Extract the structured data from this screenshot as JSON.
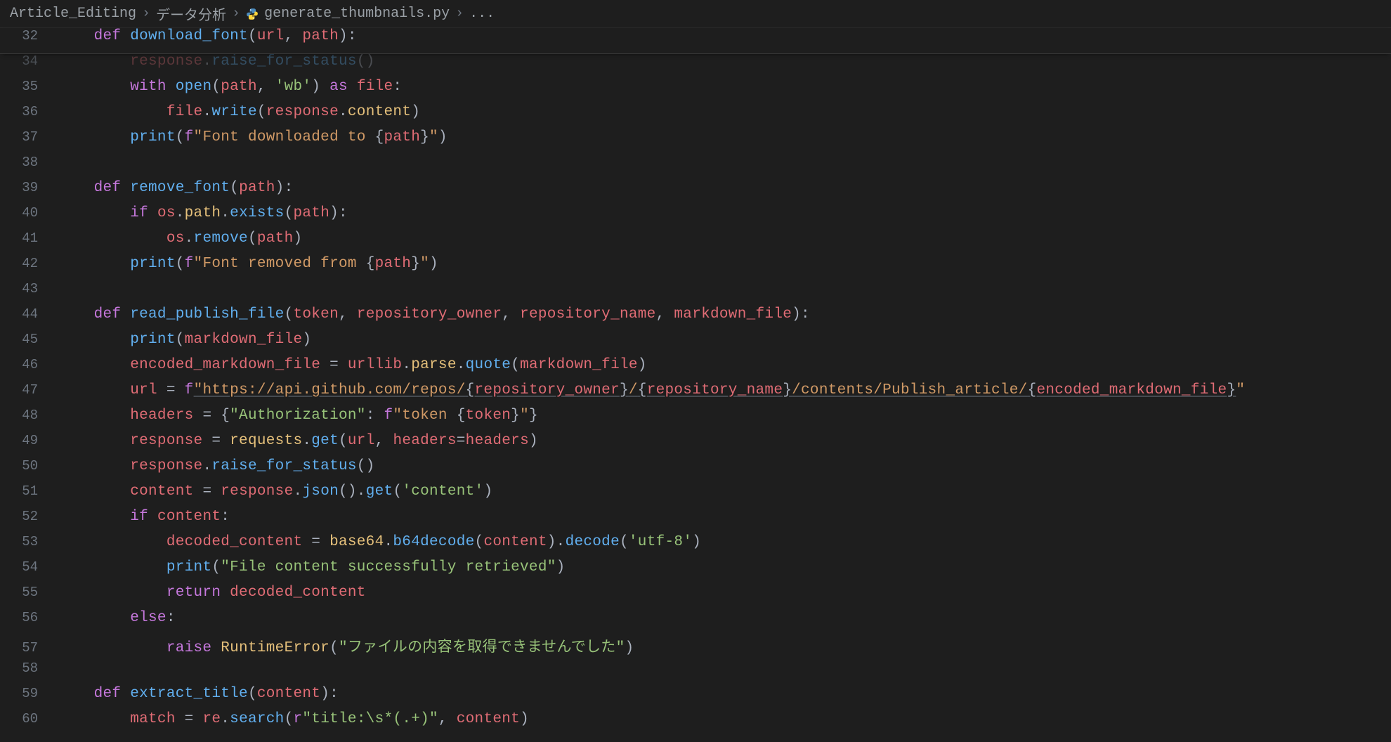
{
  "breadcrumb": {
    "parts": [
      "Article_Editing",
      "データ分析",
      "generate_thumbnails.py",
      "..."
    ],
    "file_icon": "python"
  },
  "sticky": {
    "num": "32",
    "tokens": [
      {
        "c": "kw",
        "t": "def "
      },
      {
        "c": "fn",
        "t": "download_font"
      },
      {
        "c": "op",
        "t": "("
      },
      {
        "c": "id",
        "t": "url"
      },
      {
        "c": "op",
        "t": ", "
      },
      {
        "c": "id",
        "t": "path"
      },
      {
        "c": "op",
        "t": "):"
      }
    ]
  },
  "lines": [
    {
      "num": "34",
      "faded": true,
      "indent": 2,
      "tokens": [
        {
          "c": "id",
          "t": "response"
        },
        {
          "c": "op",
          "t": "."
        },
        {
          "c": "call",
          "t": "raise_for_status"
        },
        {
          "c": "op",
          "t": "()"
        }
      ]
    },
    {
      "num": "35",
      "indent": 2,
      "tokens": [
        {
          "c": "kw",
          "t": "with"
        },
        {
          "c": "op",
          "t": " "
        },
        {
          "c": "call",
          "t": "open"
        },
        {
          "c": "op",
          "t": "("
        },
        {
          "c": "id",
          "t": "path"
        },
        {
          "c": "op",
          "t": ", "
        },
        {
          "c": "str",
          "t": "'wb'"
        },
        {
          "c": "op",
          "t": ") "
        },
        {
          "c": "kw",
          "t": "as"
        },
        {
          "c": "op",
          "t": " "
        },
        {
          "c": "id",
          "t": "file"
        },
        {
          "c": "op",
          "t": ":"
        }
      ]
    },
    {
      "num": "36",
      "indent": 3,
      "tokens": [
        {
          "c": "id",
          "t": "file"
        },
        {
          "c": "op",
          "t": "."
        },
        {
          "c": "call",
          "t": "write"
        },
        {
          "c": "op",
          "t": "("
        },
        {
          "c": "id",
          "t": "response"
        },
        {
          "c": "op",
          "t": "."
        },
        {
          "c": "attr",
          "t": "content"
        },
        {
          "c": "op",
          "t": ")"
        }
      ]
    },
    {
      "num": "37",
      "indent": 2,
      "tokens": [
        {
          "c": "call",
          "t": "print"
        },
        {
          "c": "op",
          "t": "("
        },
        {
          "c": "kw",
          "t": "f"
        },
        {
          "c": "fstr",
          "t": "\"Font downloaded to "
        },
        {
          "c": "op",
          "t": "{"
        },
        {
          "c": "interp",
          "t": "path"
        },
        {
          "c": "op",
          "t": "}"
        },
        {
          "c": "fstr",
          "t": "\""
        },
        {
          "c": "op",
          "t": ")"
        }
      ]
    },
    {
      "num": "38",
      "indent": 0,
      "tokens": []
    },
    {
      "num": "39",
      "indent": 1,
      "tokens": [
        {
          "c": "kw",
          "t": "def "
        },
        {
          "c": "fn",
          "t": "remove_font"
        },
        {
          "c": "op",
          "t": "("
        },
        {
          "c": "id",
          "t": "path"
        },
        {
          "c": "op",
          "t": "):"
        }
      ]
    },
    {
      "num": "40",
      "indent": 2,
      "tokens": [
        {
          "c": "kw",
          "t": "if"
        },
        {
          "c": "op",
          "t": " "
        },
        {
          "c": "id",
          "t": "os"
        },
        {
          "c": "op",
          "t": "."
        },
        {
          "c": "attr",
          "t": "path"
        },
        {
          "c": "op",
          "t": "."
        },
        {
          "c": "call",
          "t": "exists"
        },
        {
          "c": "op",
          "t": "("
        },
        {
          "c": "id",
          "t": "path"
        },
        {
          "c": "op",
          "t": "):"
        }
      ]
    },
    {
      "num": "41",
      "indent": 3,
      "tokens": [
        {
          "c": "id",
          "t": "os"
        },
        {
          "c": "op",
          "t": "."
        },
        {
          "c": "call",
          "t": "remove"
        },
        {
          "c": "op",
          "t": "("
        },
        {
          "c": "id",
          "t": "path"
        },
        {
          "c": "op",
          "t": ")"
        }
      ]
    },
    {
      "num": "42",
      "indent": 2,
      "tokens": [
        {
          "c": "call",
          "t": "print"
        },
        {
          "c": "op",
          "t": "("
        },
        {
          "c": "kw",
          "t": "f"
        },
        {
          "c": "fstr",
          "t": "\"Font removed from "
        },
        {
          "c": "op",
          "t": "{"
        },
        {
          "c": "interp",
          "t": "path"
        },
        {
          "c": "op",
          "t": "}"
        },
        {
          "c": "fstr",
          "t": "\""
        },
        {
          "c": "op",
          "t": ")"
        }
      ]
    },
    {
      "num": "43",
      "indent": 0,
      "tokens": []
    },
    {
      "num": "44",
      "indent": 1,
      "tokens": [
        {
          "c": "kw",
          "t": "def "
        },
        {
          "c": "fn",
          "t": "read_publish_file"
        },
        {
          "c": "op",
          "t": "("
        },
        {
          "c": "id",
          "t": "token"
        },
        {
          "c": "op",
          "t": ", "
        },
        {
          "c": "id",
          "t": "repository_owner"
        },
        {
          "c": "op",
          "t": ", "
        },
        {
          "c": "id",
          "t": "repository_name"
        },
        {
          "c": "op",
          "t": ", "
        },
        {
          "c": "id",
          "t": "markdown_file"
        },
        {
          "c": "op",
          "t": "):"
        }
      ]
    },
    {
      "num": "45",
      "indent": 2,
      "tokens": [
        {
          "c": "call",
          "t": "print"
        },
        {
          "c": "op",
          "t": "("
        },
        {
          "c": "id",
          "t": "markdown_file"
        },
        {
          "c": "op",
          "t": ")"
        }
      ]
    },
    {
      "num": "46",
      "indent": 2,
      "tokens": [
        {
          "c": "id",
          "t": "encoded_markdown_file"
        },
        {
          "c": "op",
          "t": " = "
        },
        {
          "c": "id",
          "t": "urllib"
        },
        {
          "c": "op",
          "t": "."
        },
        {
          "c": "attr",
          "t": "parse"
        },
        {
          "c": "op",
          "t": "."
        },
        {
          "c": "call",
          "t": "quote"
        },
        {
          "c": "op",
          "t": "("
        },
        {
          "c": "id",
          "t": "markdown_file"
        },
        {
          "c": "op",
          "t": ")"
        }
      ]
    },
    {
      "num": "47",
      "indent": 2,
      "tokens": [
        {
          "c": "id",
          "t": "url"
        },
        {
          "c": "op",
          "t": " = "
        },
        {
          "c": "kw",
          "t": "f"
        },
        {
          "c": "fstr url",
          "t": "\"https://api.github.com/repos/"
        },
        {
          "c": "op url",
          "t": "{"
        },
        {
          "c": "interp url",
          "t": "repository_owner"
        },
        {
          "c": "op url",
          "t": "}"
        },
        {
          "c": "fstr url",
          "t": "/"
        },
        {
          "c": "op url",
          "t": "{"
        },
        {
          "c": "interp url",
          "t": "repository_name"
        },
        {
          "c": "op url",
          "t": "}"
        },
        {
          "c": "fstr url",
          "t": "/contents/Publish_article/"
        },
        {
          "c": "op url",
          "t": "{"
        },
        {
          "c": "interp url",
          "t": "encoded_markdown_file"
        },
        {
          "c": "op url",
          "t": "}"
        },
        {
          "c": "fstr",
          "t": "\""
        }
      ]
    },
    {
      "num": "48",
      "indent": 2,
      "tokens": [
        {
          "c": "id",
          "t": "headers"
        },
        {
          "c": "op",
          "t": " = {"
        },
        {
          "c": "str",
          "t": "\"Authorization\""
        },
        {
          "c": "op",
          "t": ": "
        },
        {
          "c": "kw",
          "t": "f"
        },
        {
          "c": "fstr",
          "t": "\"token "
        },
        {
          "c": "op",
          "t": "{"
        },
        {
          "c": "interp",
          "t": "token"
        },
        {
          "c": "op",
          "t": "}"
        },
        {
          "c": "fstr",
          "t": "\""
        },
        {
          "c": "op",
          "t": "}"
        }
      ]
    },
    {
      "num": "49",
      "indent": 2,
      "tokens": [
        {
          "c": "id",
          "t": "response"
        },
        {
          "c": "op",
          "t": " = "
        },
        {
          "c": "attr",
          "t": "requests"
        },
        {
          "c": "op",
          "t": "."
        },
        {
          "c": "call",
          "t": "get"
        },
        {
          "c": "op",
          "t": "("
        },
        {
          "c": "id",
          "t": "url"
        },
        {
          "c": "op",
          "t": ", "
        },
        {
          "c": "id",
          "t": "headers"
        },
        {
          "c": "op",
          "t": "="
        },
        {
          "c": "id",
          "t": "headers"
        },
        {
          "c": "op",
          "t": ")"
        }
      ]
    },
    {
      "num": "50",
      "indent": 2,
      "tokens": [
        {
          "c": "id",
          "t": "response"
        },
        {
          "c": "op",
          "t": "."
        },
        {
          "c": "call",
          "t": "raise_for_status"
        },
        {
          "c": "op",
          "t": "()"
        }
      ]
    },
    {
      "num": "51",
      "indent": 2,
      "tokens": [
        {
          "c": "id",
          "t": "content"
        },
        {
          "c": "op",
          "t": " = "
        },
        {
          "c": "id",
          "t": "response"
        },
        {
          "c": "op",
          "t": "."
        },
        {
          "c": "call",
          "t": "json"
        },
        {
          "c": "op",
          "t": "()."
        },
        {
          "c": "call",
          "t": "get"
        },
        {
          "c": "op",
          "t": "("
        },
        {
          "c": "str",
          "t": "'content'"
        },
        {
          "c": "op",
          "t": ")"
        }
      ]
    },
    {
      "num": "52",
      "indent": 2,
      "tokens": [
        {
          "c": "kw",
          "t": "if"
        },
        {
          "c": "op",
          "t": " "
        },
        {
          "c": "id",
          "t": "content"
        },
        {
          "c": "op",
          "t": ":"
        }
      ]
    },
    {
      "num": "53",
      "indent": 3,
      "tokens": [
        {
          "c": "id",
          "t": "decoded_content"
        },
        {
          "c": "op",
          "t": " = "
        },
        {
          "c": "attr",
          "t": "base64"
        },
        {
          "c": "op",
          "t": "."
        },
        {
          "c": "call",
          "t": "b64decode"
        },
        {
          "c": "op",
          "t": "("
        },
        {
          "c": "id",
          "t": "content"
        },
        {
          "c": "op",
          "t": ")."
        },
        {
          "c": "call",
          "t": "decode"
        },
        {
          "c": "op",
          "t": "("
        },
        {
          "c": "str",
          "t": "'utf-8'"
        },
        {
          "c": "op",
          "t": ")"
        }
      ]
    },
    {
      "num": "54",
      "indent": 3,
      "tokens": [
        {
          "c": "call",
          "t": "print"
        },
        {
          "c": "op",
          "t": "("
        },
        {
          "c": "str",
          "t": "\"File content successfully retrieved\""
        },
        {
          "c": "op",
          "t": ")"
        }
      ]
    },
    {
      "num": "55",
      "indent": 3,
      "tokens": [
        {
          "c": "kw",
          "t": "return"
        },
        {
          "c": "op",
          "t": " "
        },
        {
          "c": "id",
          "t": "decoded_content"
        }
      ]
    },
    {
      "num": "56",
      "indent": 2,
      "tokens": [
        {
          "c": "kw",
          "t": "else"
        },
        {
          "c": "op",
          "t": ":"
        }
      ]
    },
    {
      "num": "57",
      "indent": 3,
      "tokens": [
        {
          "c": "kw",
          "t": "raise"
        },
        {
          "c": "op",
          "t": " "
        },
        {
          "c": "cls",
          "t": "RuntimeError"
        },
        {
          "c": "op",
          "t": "("
        },
        {
          "c": "str",
          "t": "\"ファイルの内容を取得できませんでした\""
        },
        {
          "c": "op",
          "t": ")"
        }
      ]
    },
    {
      "num": "58",
      "indent": 0,
      "tokens": []
    },
    {
      "num": "59",
      "indent": 1,
      "tokens": [
        {
          "c": "kw",
          "t": "def "
        },
        {
          "c": "fn",
          "t": "extract_title"
        },
        {
          "c": "op",
          "t": "("
        },
        {
          "c": "id",
          "t": "content"
        },
        {
          "c": "op",
          "t": "):"
        }
      ]
    },
    {
      "num": "60",
      "indent": 2,
      "tokens": [
        {
          "c": "id",
          "t": "match"
        },
        {
          "c": "op",
          "t": " = "
        },
        {
          "c": "id",
          "t": "re"
        },
        {
          "c": "op",
          "t": "."
        },
        {
          "c": "call",
          "t": "search"
        },
        {
          "c": "op",
          "t": "("
        },
        {
          "c": "kw",
          "t": "r"
        },
        {
          "c": "str",
          "t": "\"title:\\s*(.+)\""
        },
        {
          "c": "op",
          "t": ", "
        },
        {
          "c": "id",
          "t": "content"
        },
        {
          "c": "op",
          "t": ")"
        }
      ]
    }
  ]
}
